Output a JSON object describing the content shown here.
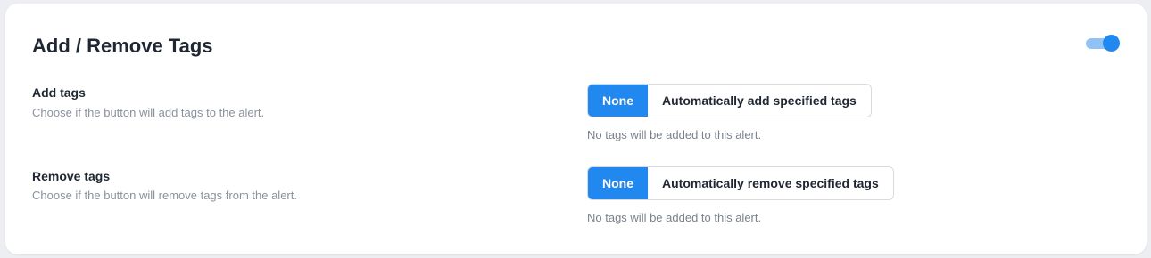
{
  "section": {
    "title": "Add / Remove Tags",
    "enabled": true
  },
  "add_tags": {
    "label": "Add tags",
    "description": "Choose if the button will add tags to the alert.",
    "options": [
      "None",
      "Automatically add specified tags"
    ],
    "selected": "None",
    "hint": "No tags will be added to this alert."
  },
  "remove_tags": {
    "label": "Remove tags",
    "description": "Choose if the button will remove tags from the alert.",
    "options": [
      "None",
      "Automatically remove specified tags"
    ],
    "selected": "None",
    "hint": "No tags will be added to this alert."
  },
  "colors": {
    "accent": "#2188f0",
    "toggle_track": "#90c2f5"
  }
}
